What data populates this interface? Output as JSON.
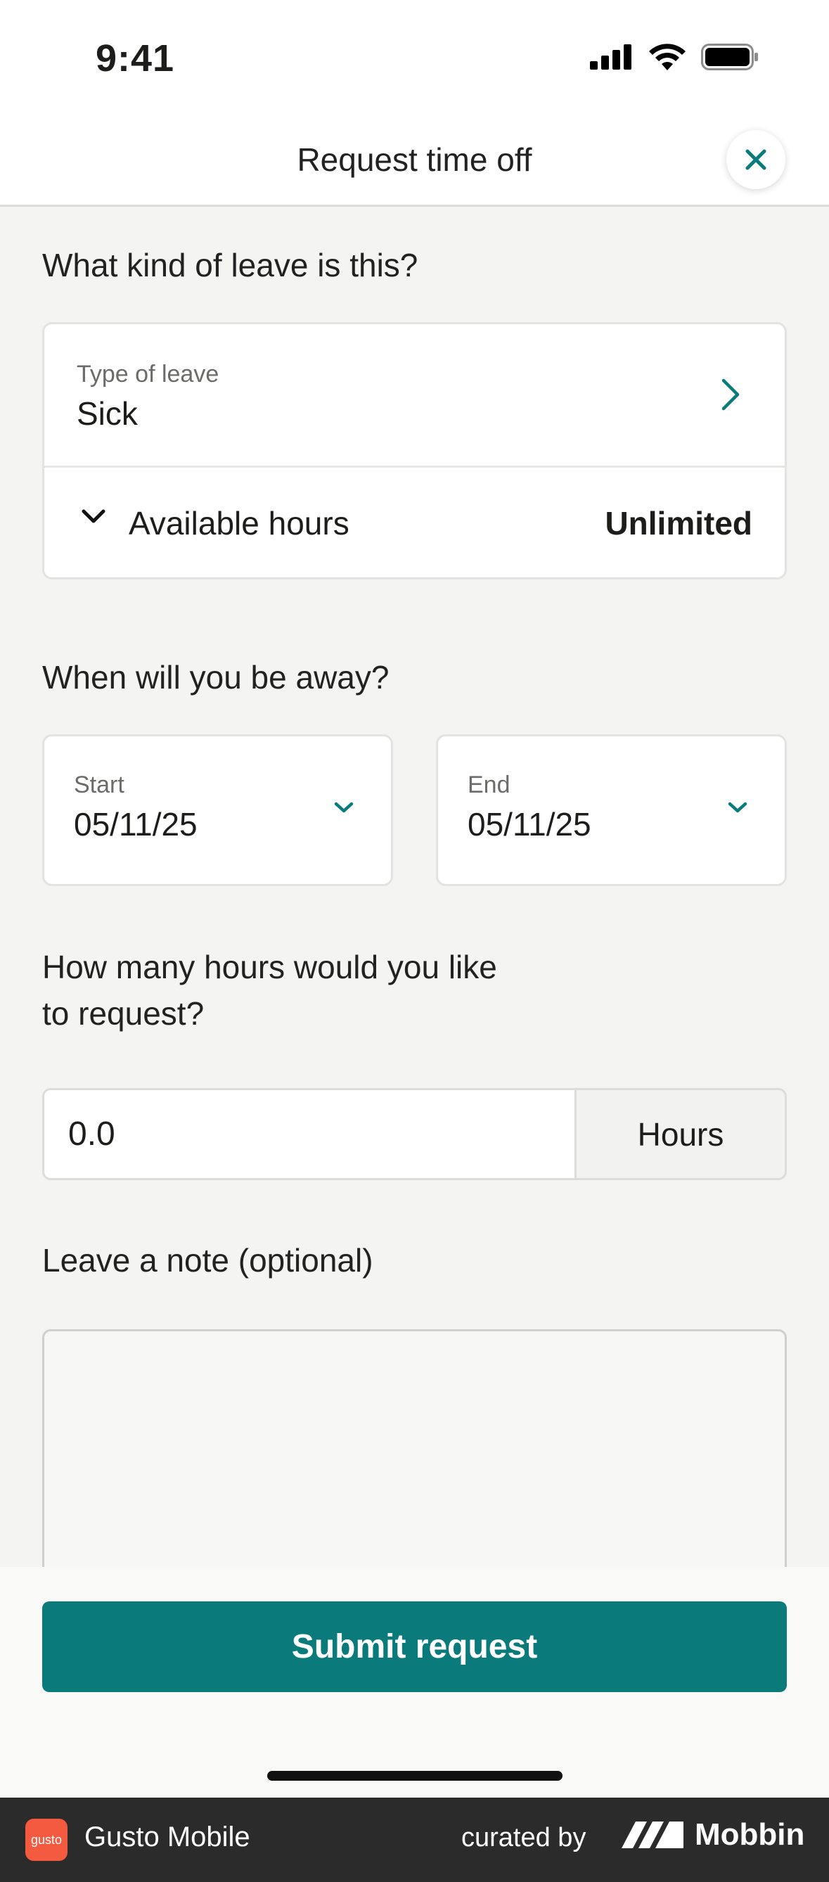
{
  "status_bar": {
    "time": "9:41"
  },
  "nav": {
    "title": "Request time off"
  },
  "leave_section": {
    "title": "What kind of leave is this?",
    "type_label": "Type of leave",
    "type_value": "Sick",
    "available_label": "Available hours",
    "available_value": "Unlimited"
  },
  "dates_section": {
    "title": "When will you be away?",
    "start_label": "Start",
    "start_value": "05/11/25",
    "end_label": "End",
    "end_value": "05/11/25"
  },
  "hours_section": {
    "title_line1": "How many hours would you like",
    "title_line2": "to request?",
    "value": "0.0",
    "unit": "Hours"
  },
  "note_section": {
    "title": "Leave a note (optional)",
    "value": ""
  },
  "actions": {
    "submit_label": "Submit request"
  },
  "footer": {
    "app_logo_text": "gusto",
    "app_name": "Gusto Mobile",
    "curated_by": "curated by",
    "brand": "Mobbin"
  },
  "colors": {
    "accent": "#0a7b7a",
    "background": "#f4f4f3",
    "footer": "#2b2b2b",
    "logo": "#f35a3f"
  }
}
